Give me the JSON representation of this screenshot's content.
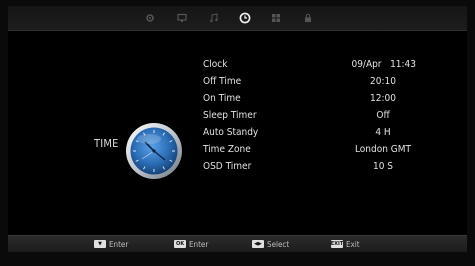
{
  "tabs": [
    {
      "icon": "picture-gear-icon",
      "active": false
    },
    {
      "icon": "monitor-icon",
      "active": false
    },
    {
      "icon": "music-note-icon",
      "active": false
    },
    {
      "icon": "clock-icon",
      "active": true
    },
    {
      "icon": "grid-icon",
      "active": false
    },
    {
      "icon": "lock-icon",
      "active": false
    }
  ],
  "section": {
    "title": "TIME",
    "icon": "clock-face-icon"
  },
  "settings": [
    {
      "label": "Clock",
      "value": "09/Apr   11:43"
    },
    {
      "label": "Off Time",
      "value": "20:10"
    },
    {
      "label": "On Time",
      "value": "12:00"
    },
    {
      "label": "Sleep Timer",
      "value": "Off"
    },
    {
      "label": "Auto Standy",
      "value": "4 H"
    },
    {
      "label": "Time Zone",
      "value": "London GMT"
    },
    {
      "label": "OSD Timer",
      "value": "10 S"
    }
  ],
  "footer": [
    {
      "key_icon": "enter-key-icon",
      "key": "▼",
      "label": "Enter"
    },
    {
      "key_icon": "ok-key-icon",
      "key": "OK",
      "label": "Enter"
    },
    {
      "key_icon": "left-right-key-icon",
      "key": "◀▶",
      "label": "Select"
    },
    {
      "key_icon": "exit-key-icon",
      "key": "EXIT",
      "label": "Exit"
    }
  ],
  "colors": {
    "background": "#000000",
    "text": "#e2e2e2",
    "clock_blue": "#2d6fb8"
  }
}
